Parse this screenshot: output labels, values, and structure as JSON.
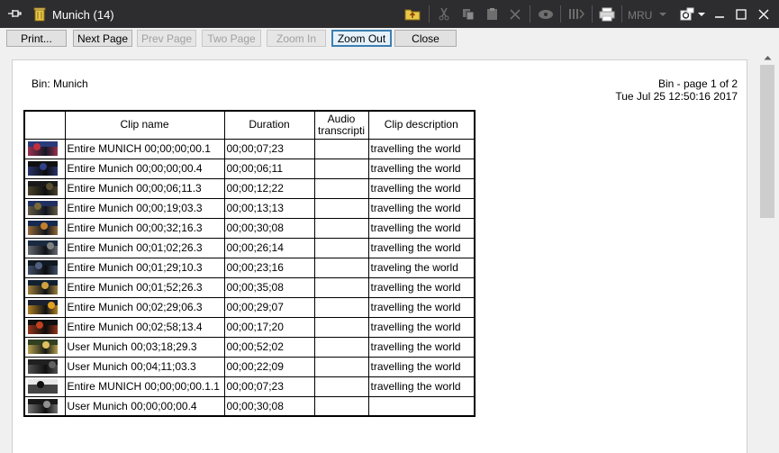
{
  "window": {
    "title": "Munich (14)",
    "toolbar_icons": [
      "pin-icon",
      "trash-icon",
      "folder-up-icon",
      "cut-icon",
      "copy-icon",
      "paste-icon",
      "delete-icon",
      "preview-icon",
      "columns-icon",
      "print-icon",
      "mru-dropdown",
      "settings-icon",
      "minimize-icon",
      "maximize-icon",
      "close-icon"
    ],
    "mru_label": "MRU"
  },
  "buttons": {
    "print": "Print...",
    "next_page": "Next Page",
    "prev_page": "Prev Page",
    "two_page": "Two Page",
    "zoom_in": "Zoom In",
    "zoom_out": "Zoom Out",
    "close": "Close"
  },
  "report": {
    "bin_label": "Bin: Munich",
    "page_info": "Bin - page  1 of 2",
    "date": "Tue Jul 25 12:50:16 2017",
    "columns": [
      "",
      "Clip name",
      "Duration",
      "Audio transcripti",
      "Clip description"
    ],
    "rows": [
      {
        "name": "Entire MUNICH 00;00;00;00.1",
        "duration": "00;00;07;23",
        "audio": "",
        "description": "travelling the world"
      },
      {
        "name": "Entire Munich 00;00;00;00.4",
        "duration": "00;00;06;11",
        "audio": "",
        "description": "travelling the world"
      },
      {
        "name": "Entire Munich 00;00;06;11.3",
        "duration": "00;00;12;22",
        "audio": "",
        "description": "travelling the world"
      },
      {
        "name": "Entire Munich 00;00;19;03.3",
        "duration": "00;00;13;13",
        "audio": "",
        "description": "travelling the world"
      },
      {
        "name": "Entire Munich 00;00;32;16.3",
        "duration": "00;00;30;08",
        "audio": "",
        "description": "travelling the world"
      },
      {
        "name": "Entire Munich 00;01;02;26.3",
        "duration": "00;00;26;14",
        "audio": "",
        "description": "travelling the world"
      },
      {
        "name": "Entire Munich 00;01;29;10.3",
        "duration": "00;00;23;16",
        "audio": "",
        "description": "traveling the world"
      },
      {
        "name": "Entire Munich 00;01;52;26.3",
        "duration": "00;00;35;08",
        "audio": "",
        "description": "travelling the world"
      },
      {
        "name": "Entire Munich 00;02;29;06.3",
        "duration": "00;00;29;07",
        "audio": "",
        "description": "travelling the world"
      },
      {
        "name": "Entire Munich 00;02;58;13.4",
        "duration": "00;00;17;20",
        "audio": "",
        "description": "travelling the world"
      },
      {
        "name": "User Munich 00;03;18;29.3",
        "duration": "00;00;52;02",
        "audio": "",
        "description": "travelling the world"
      },
      {
        "name": "User Munich 00;04;11;03.3",
        "duration": "00;00;22;09",
        "audio": "",
        "description": "travelling the world"
      },
      {
        "name": "Entire MUNICH 00;00;00;00.1.1",
        "duration": "00;00;07;23",
        "audio": "",
        "description": "travelling the world"
      },
      {
        "name": "User Munich 00;00;00;00.4",
        "duration": "00;00;30;08",
        "audio": "",
        "description": ""
      }
    ]
  }
}
